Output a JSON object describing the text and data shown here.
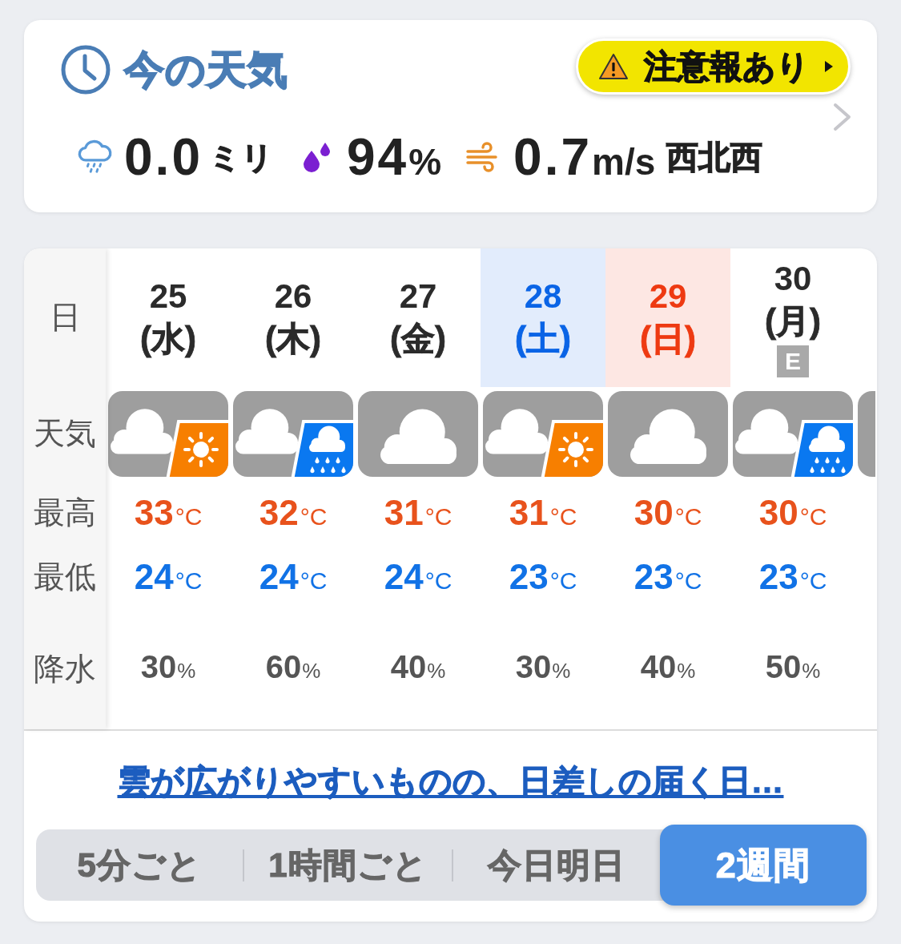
{
  "current": {
    "title": "今の天気",
    "alert": {
      "label": "注意報あり"
    },
    "rainfall": {
      "value": "0.0",
      "unit": "ミリ"
    },
    "humidity": {
      "value": "94",
      "unit": "%"
    },
    "wind": {
      "value": "0.7",
      "unit": "m/s",
      "direction": "西北西"
    }
  },
  "forecast": {
    "row_labels": {
      "date": "日",
      "weather": "天気",
      "high": "最高",
      "low": "最低",
      "precip": "降水"
    },
    "days": [
      {
        "date": "25",
        "weekday": "(水)",
        "color": "#2b2b2b",
        "highlighted": false,
        "kind": "cloudy-sunny",
        "high": {
          "value": "33",
          "unit": "°C"
        },
        "low": {
          "value": "24",
          "unit": "°C"
        },
        "precip": {
          "value": "30",
          "unit": "%"
        }
      },
      {
        "date": "26",
        "weekday": "(木)",
        "color": "#2b2b2b",
        "highlighted": false,
        "kind": "cloudy-rainy",
        "high": {
          "value": "32",
          "unit": "°C"
        },
        "low": {
          "value": "24",
          "unit": "°C"
        },
        "precip": {
          "value": "60",
          "unit": "%"
        }
      },
      {
        "date": "27",
        "weekday": "(金)",
        "color": "#2b2b2b",
        "highlighted": false,
        "kind": "cloudy",
        "high": {
          "value": "31",
          "unit": "°C"
        },
        "low": {
          "value": "24",
          "unit": "°C"
        },
        "precip": {
          "value": "40",
          "unit": "%"
        }
      },
      {
        "date": "28",
        "weekday": "(土)",
        "color": "#0a64e6",
        "highlighted": true,
        "kind": "cloudy-sunny",
        "high": {
          "value": "31",
          "unit": "°C"
        },
        "low": {
          "value": "23",
          "unit": "°C"
        },
        "precip": {
          "value": "30",
          "unit": "%"
        }
      },
      {
        "date": "29",
        "weekday": "(日)",
        "color": "#ee3a12",
        "highlighted": true,
        "kind": "cloudy",
        "high": {
          "value": "30",
          "unit": "°C"
        },
        "low": {
          "value": "23",
          "unit": "°C"
        },
        "precip": {
          "value": "40",
          "unit": "%"
        }
      },
      {
        "date": "30",
        "weekday": "(月)",
        "color": "#2b2b2b",
        "highlighted": false,
        "kind": "cloudy-rainy",
        "badge": "E",
        "high": {
          "value": "30",
          "unit": "°C"
        },
        "low": {
          "value": "23",
          "unit": "°C"
        },
        "precip": {
          "value": "50",
          "unit": "%"
        }
      }
    ],
    "next_day_peek": true,
    "summary_link": "雲が広がりやすいものの、日差しの届く日…"
  },
  "range_tabs": [
    {
      "label": "5分ごと",
      "selected": false
    },
    {
      "label": "1時間ごと",
      "selected": false
    },
    {
      "label": "今日明日",
      "selected": false
    },
    {
      "label": "2週間",
      "selected": true
    }
  ]
}
